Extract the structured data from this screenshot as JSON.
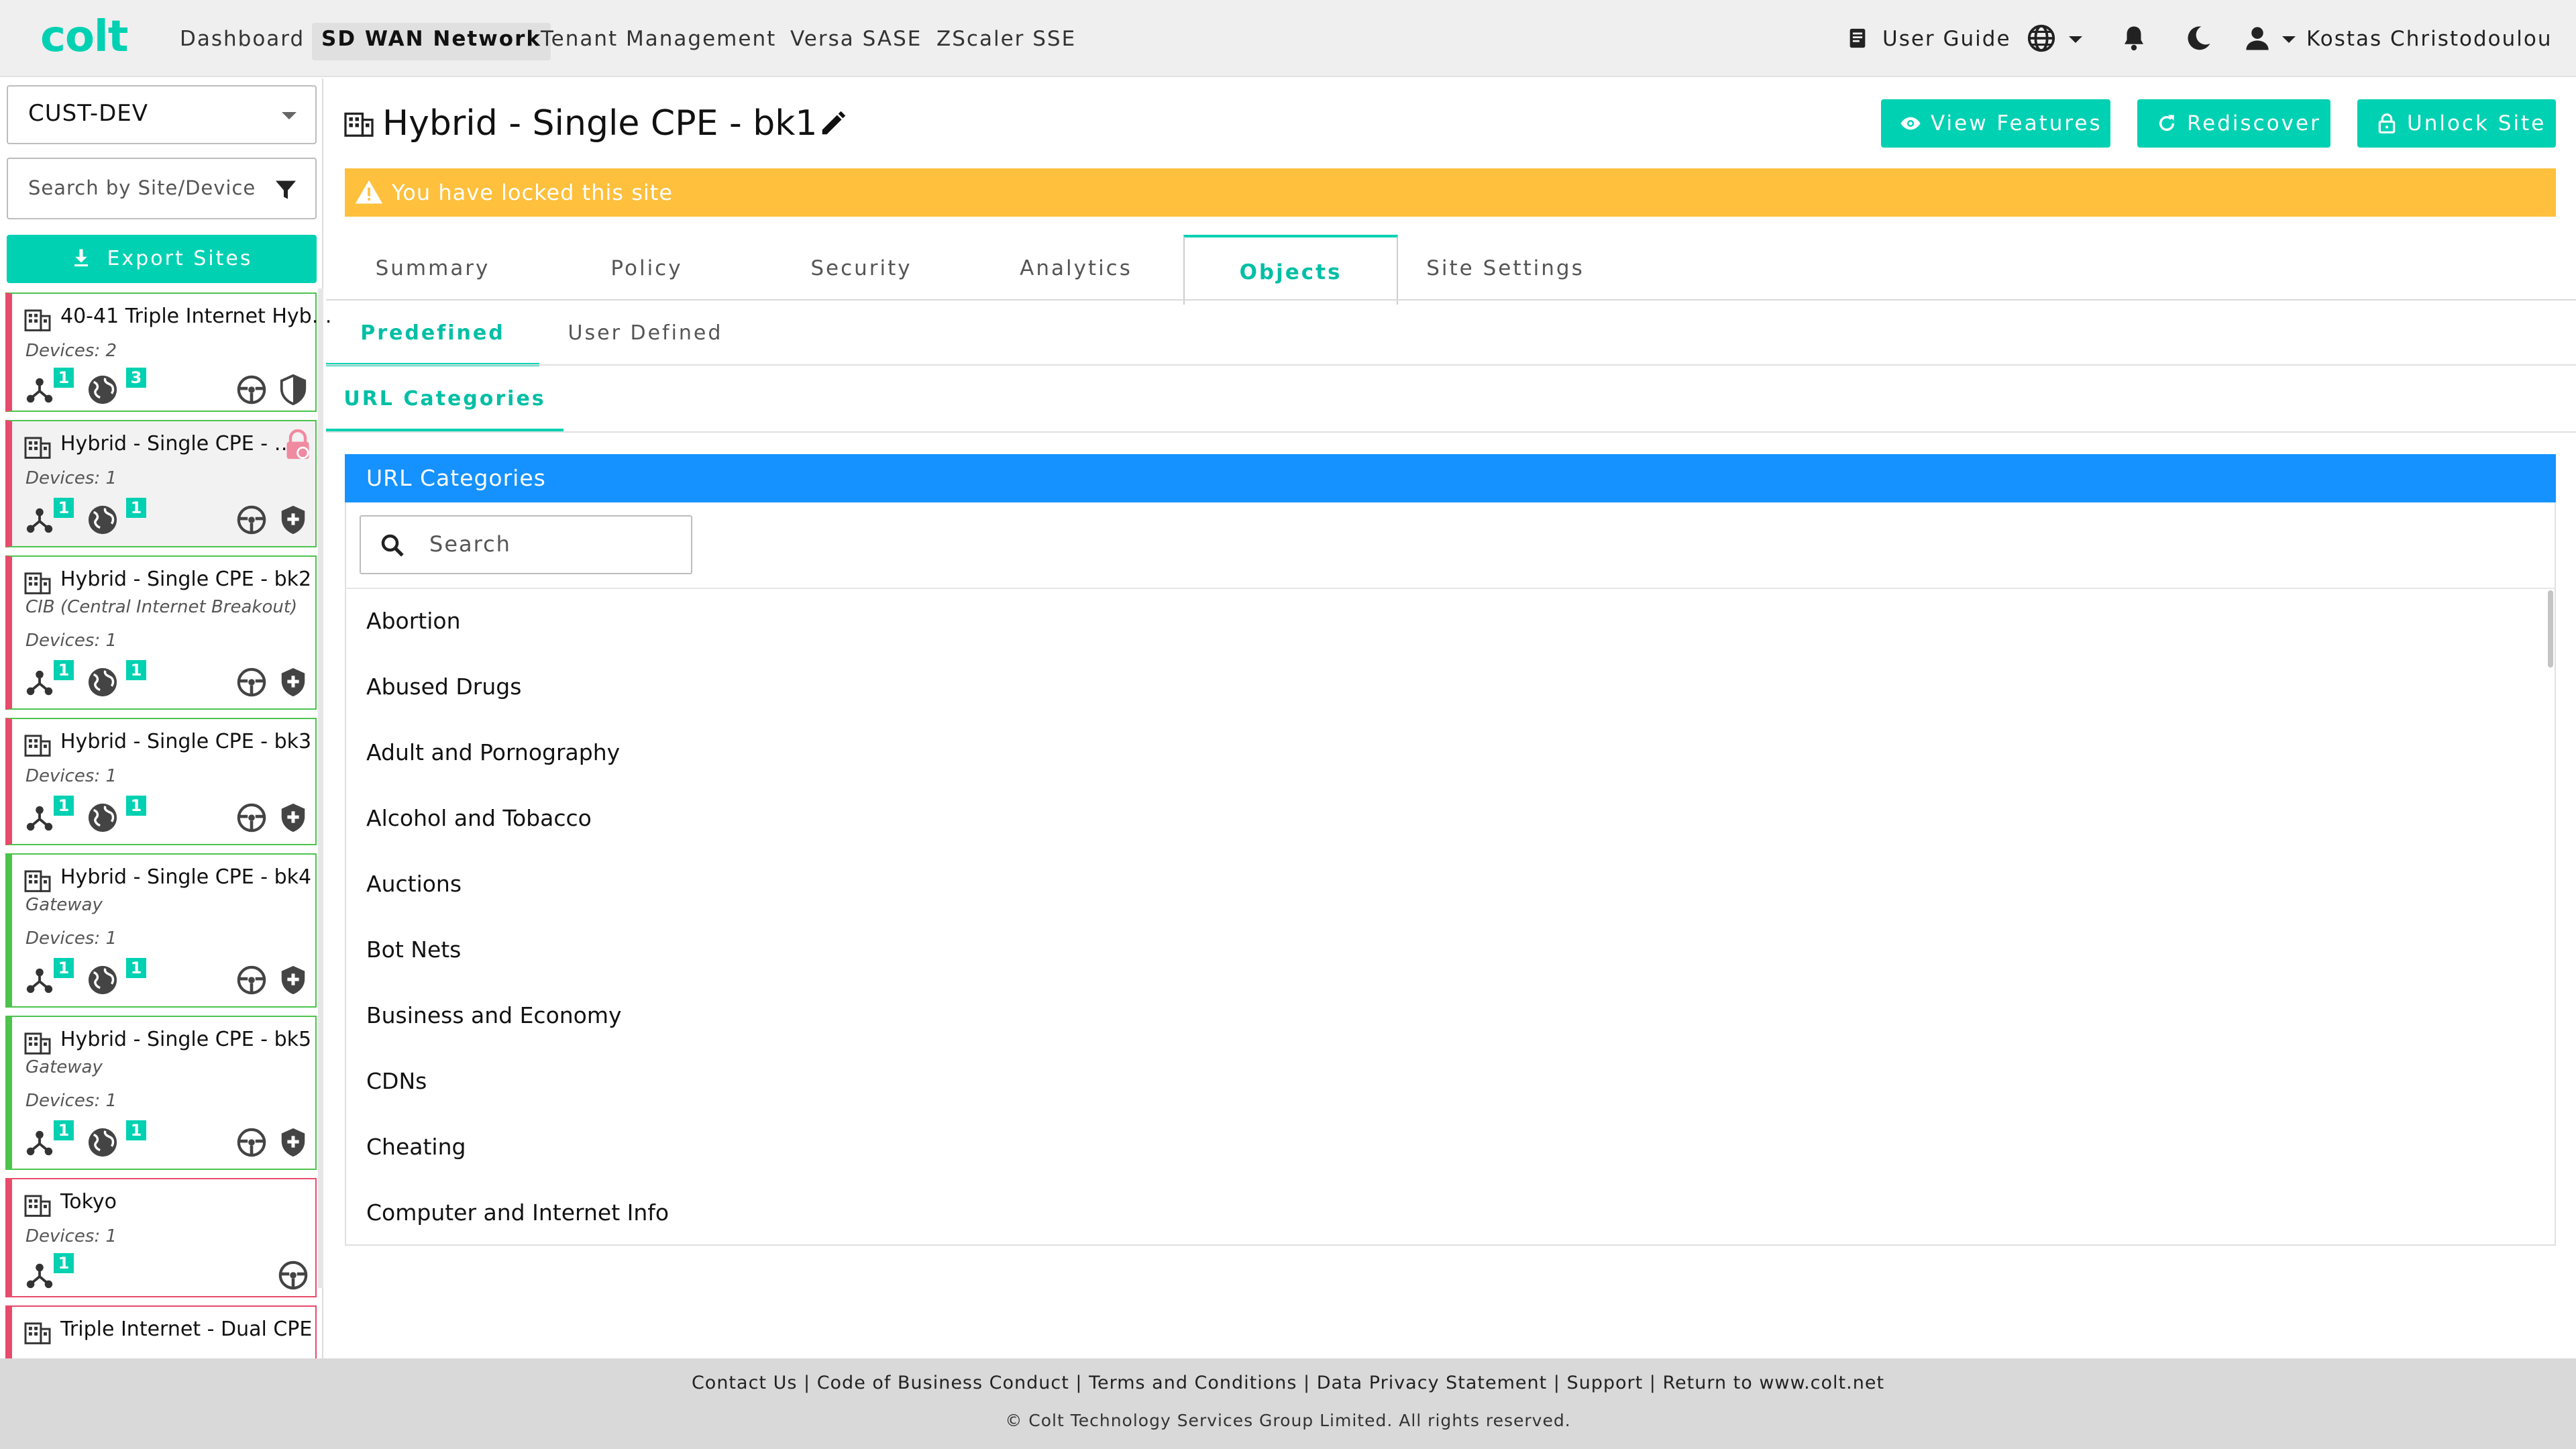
{
  "header": {
    "logo": "colt",
    "nav": [
      "Dashboard",
      "SD WAN Network",
      "Tenant Management",
      "Versa SASE",
      "ZScaler SSE"
    ],
    "user_guide": "User Guide",
    "user_name": "Kostas Christodoulou"
  },
  "sidebar": {
    "customer": "CUST-DEV",
    "search_placeholder": "Search by Site/Device",
    "export_label": "Export Sites",
    "sites": [
      {
        "name": "40-41 Triple Internet Hyb…",
        "devices": "Devices: 2",
        "badge_a": "1",
        "badge_b": "3"
      },
      {
        "name": "Hybrid - Single CPE - …",
        "devices": "Devices: 1",
        "badge_a": "1",
        "badge_b": "1"
      },
      {
        "name": "Hybrid - Single CPE - bk2",
        "role": "CIB (Central Internet Breakout)",
        "devices": "Devices: 1",
        "badge_a": "1",
        "badge_b": "1"
      },
      {
        "name": "Hybrid - Single CPE - bk3",
        "devices": "Devices: 1",
        "badge_a": "1",
        "badge_b": "1"
      },
      {
        "name": "Hybrid - Single CPE - bk4",
        "role": "Gateway",
        "devices": "Devices: 1",
        "badge_a": "1",
        "badge_b": "1"
      },
      {
        "name": "Hybrid - Single CPE - bk5",
        "role": "Gateway",
        "devices": "Devices: 1",
        "badge_a": "1",
        "badge_b": "1"
      },
      {
        "name": "Tokyo",
        "devices": "Devices: 1",
        "badge_a": "1"
      },
      {
        "name": "Triple Internet - Dual CPE"
      }
    ]
  },
  "main": {
    "title": "Hybrid - Single CPE - bk1",
    "buttons": {
      "view_features": "View Features",
      "rediscover": "Rediscover",
      "unlock": "Unlock Site"
    },
    "lock_banner": "You have locked this site",
    "tabs": [
      "Summary",
      "Policy",
      "Security",
      "Analytics",
      "Objects",
      "Site Settings"
    ],
    "subtabs": [
      "Predefined",
      "User Defined"
    ],
    "section_tab": "URL Categories",
    "panel_title": "URL Categories",
    "panel_search_placeholder": "Search",
    "categories": [
      "Abortion",
      "Abused Drugs",
      "Adult and Pornography",
      "Alcohol and Tobacco",
      "Auctions",
      "Bot Nets",
      "Business and Economy",
      "CDNs",
      "Cheating",
      "Computer and Internet Info"
    ]
  },
  "footer": {
    "links": [
      "Contact Us",
      "Code of Business Conduct",
      "Terms and Conditions",
      "Data Privacy Statement",
      "Support",
      "Return to www.colt.net"
    ],
    "copyright": "© Colt Technology Services Group Limited. All rights reserved."
  },
  "colors": {
    "accent": "#00d1b2",
    "panel_header": "#1592ff",
    "warning": "#fec03d",
    "alarm": "#e84a6b",
    "ok": "#4cc44c"
  }
}
